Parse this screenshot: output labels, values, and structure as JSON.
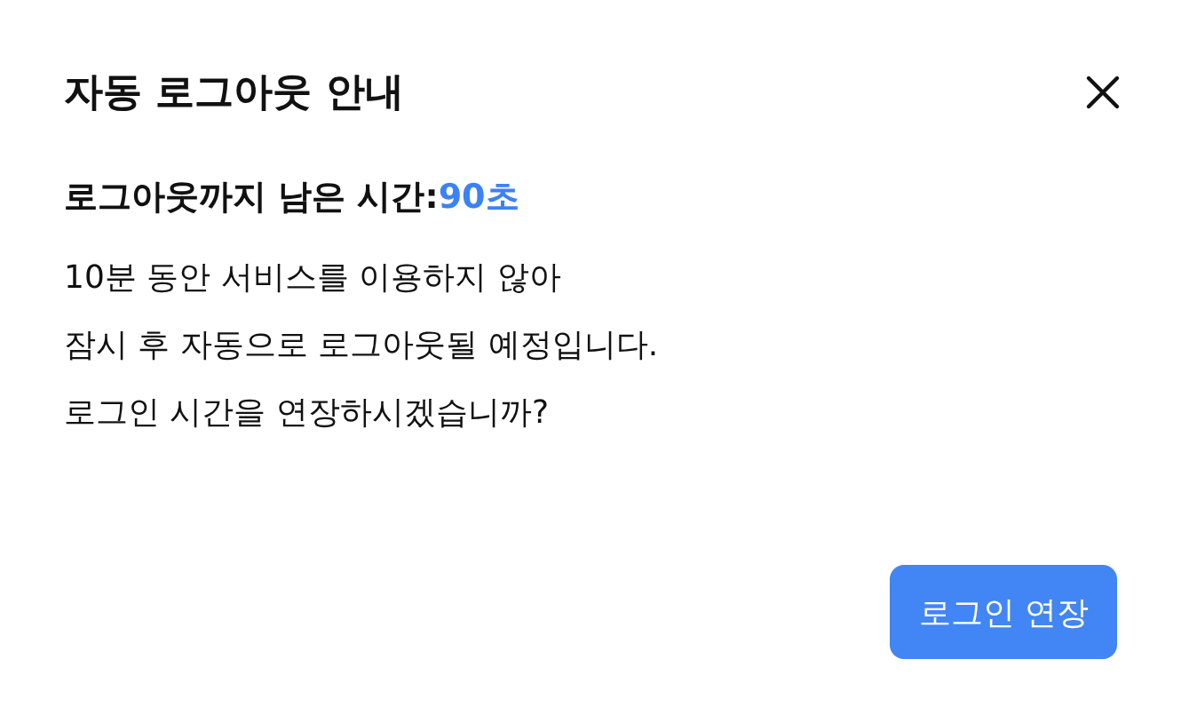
{
  "dialog": {
    "title": "자동 로그아웃 안내",
    "countdown": {
      "label": "로그아웃까지 남은 시간:",
      "value": "90초"
    },
    "message_lines": [
      "10분 동안 서비스를 이용하지 않아",
      "잠시 후 자동으로 로그아웃될 예정입니다.",
      "로그인 시간을 연장하시겠습니까?"
    ],
    "buttons": [
      "로그인 연장"
    ]
  }
}
